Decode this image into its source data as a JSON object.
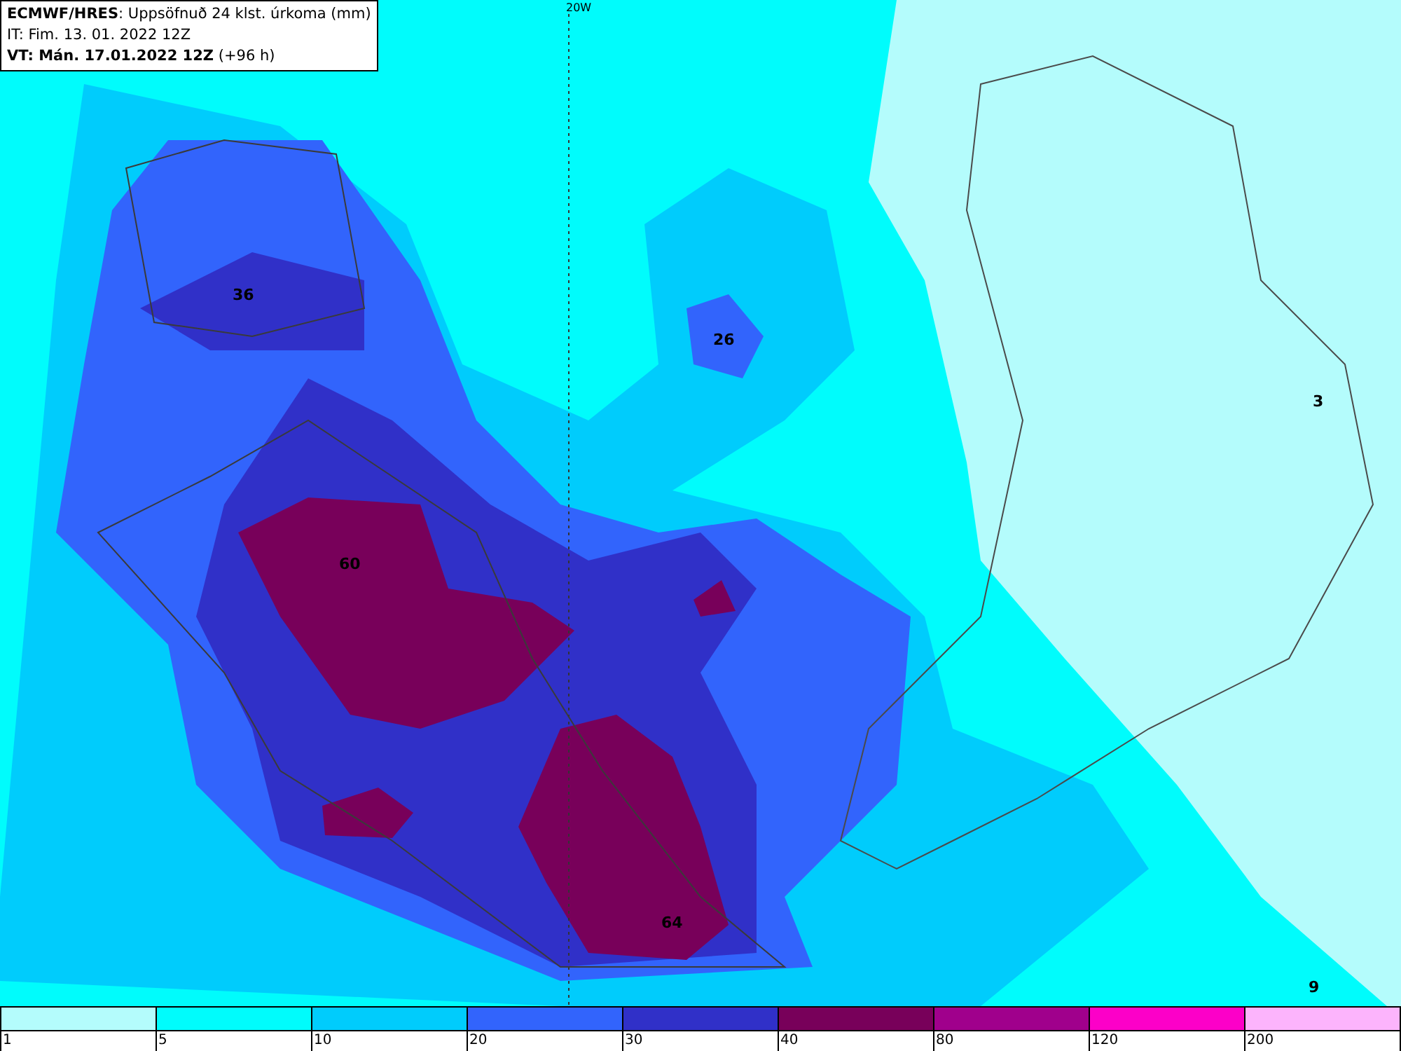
{
  "header": {
    "lines": [
      "**ECMWF/HRES**: Uppsöfnuð 24 klst. úrkoma (mm)",
      "IT: Fim. 13. 01. 2022 12Z",
      "**VT: Mán. 17.01.2022 12Z** (+96 h)"
    ]
  },
  "map": {
    "meridian_label": "20W",
    "contour_labels": [
      "36",
      "26",
      "3",
      "60",
      "64",
      "9"
    ]
  },
  "legend": {
    "bins": [
      {
        "label": "1",
        "color": "#b4fcfc"
      },
      {
        "label": "5",
        "color": "#00fcfc"
      },
      {
        "label": "10",
        "color": "#00ccfc"
      },
      {
        "label": "20",
        "color": "#3264fc"
      },
      {
        "label": "30",
        "color": "#3030c8"
      },
      {
        "label": "40",
        "color": "#78005a"
      },
      {
        "label": "80",
        "color": "#a0008c"
      },
      {
        "label": "120",
        "color": "#fc00c8"
      },
      {
        "label": "200",
        "color": "#fcb4fc"
      }
    ]
  }
}
